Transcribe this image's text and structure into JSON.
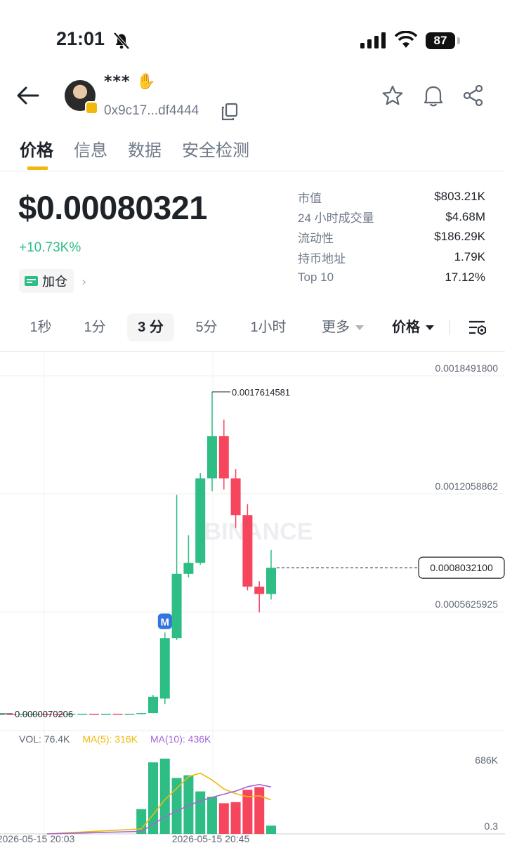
{
  "status_bar": {
    "time": "21:01",
    "battery": "87"
  },
  "header": {
    "token_name": "***",
    "address": "0x9c17...df4444"
  },
  "tabs": [
    {
      "label": "价格",
      "active": true
    },
    {
      "label": "信息",
      "active": false
    },
    {
      "label": "数据",
      "active": false
    },
    {
      "label": "安全检测",
      "active": false
    }
  ],
  "price": {
    "value": "$0.00080321",
    "change": "+10.73K%",
    "add_position_label": "加仓"
  },
  "stats": [
    {
      "label": "市值",
      "value": "$803.21K"
    },
    {
      "label": "24 小时成交量",
      "value": "$4.68M"
    },
    {
      "label": "流动性",
      "value": "$186.29K"
    },
    {
      "label": "持币地址",
      "value": "1.79K"
    },
    {
      "label": "Top 10",
      "value": "17.12%"
    }
  ],
  "intervals": {
    "s1": "1秒",
    "m1": "1分",
    "m3": "3 分",
    "m5": "5分",
    "h1": "1小时",
    "more": "更多",
    "price_type": "价格",
    "selected": "3 分"
  },
  "colors": {
    "up": "#2ebd85",
    "down": "#f6465d",
    "accent": "#f0b90b",
    "ma5": "#f0b90b",
    "ma10": "#a467d6"
  },
  "chart_data": {
    "type": "candlestick",
    "watermark": "BINANCE",
    "price_axis_labels": [
      "0.0018491800",
      "0.0012058862",
      "0.0005625925"
    ],
    "current_price_label": "0.0008032100",
    "high_label": "0.0017614581",
    "low_label": "0.0000070206",
    "marker": "M",
    "time_labels": [
      "2026-05-15 20:03",
      "2026-05-15 20:45"
    ],
    "candles": [
      [
        7e-06,
        7.2e-06,
        7e-06,
        7.3e-06
      ],
      [
        7.2e-06,
        7.1e-06,
        7e-06,
        7.3e-06
      ],
      [
        7.1e-06,
        7.2e-06,
        7e-06,
        7.3e-06
      ],
      [
        7.2e-06,
        7e-06,
        6.9e-06,
        7.3e-06
      ],
      [
        7e-06,
        7.1e-06,
        6.9e-06,
        7.2e-06
      ],
      [
        7.1e-06,
        7.3e-06,
        7e-06,
        7.4e-06
      ],
      [
        7.3e-06,
        7.2e-06,
        7.1e-06,
        7.4e-06
      ],
      [
        7.2e-06,
        7.1e-06,
        7e-06,
        7.3e-06
      ],
      [
        7.1e-06,
        7.2e-06,
        7e-06,
        7.3e-06
      ],
      [
        7.2e-06,
        7.3e-06,
        7.1e-06,
        7.4e-06
      ],
      [
        7.3e-06,
        7.2e-06,
        7.1e-06,
        7.4e-06
      ],
      [
        7.2e-06,
        7.3e-06,
        7.1e-06,
        7.4e-06
      ],
      [
        7.3e-06,
        7.2e-06,
        7.1e-06,
        7.4e-06
      ],
      [
        7.2e-06,
        7.4e-06,
        7.1e-06,
        7.5e-06
      ],
      [
        7.4e-06,
        1.1e-05,
        7e-06,
        1.2e-05
      ],
      [
        1.1e-05,
        0.0001,
        1e-05,
        0.00011
      ],
      [
        9e-05,
        0.00042,
        6e-05,
        0.00045
      ],
      [
        0.00042,
        0.00077,
        0.00041,
        0.0012
      ],
      [
        0.00077,
        0.00083,
        0.00075,
        0.00098
      ],
      [
        0.00083,
        0.00129,
        0.00082,
        0.00132
      ],
      [
        0.00129,
        0.00152,
        0.00122,
        0.0017614581
      ],
      [
        0.00152,
        0.00129,
        0.00123,
        0.00161
      ],
      [
        0.00129,
        0.00109,
        0.00102,
        0.00134
      ],
      [
        0.00109,
        0.0007,
        0.00068,
        0.00115
      ],
      [
        0.0007,
        0.00066,
        0.00056,
        0.00073
      ],
      [
        0.00066,
        0.0008032,
        0.00063,
        0.0009
      ]
    ],
    "volume": {
      "label": "VOL: 76.4K",
      "ma5_label": "MA(5): 316K",
      "ma10_label": "MA(10): 436K",
      "axis_labels": [
        "686K",
        "0.3"
      ],
      "values": [
        0.3,
        0.3,
        0.3,
        0.3,
        0.3,
        0.3,
        0.3,
        0.3,
        0.3,
        0.3,
        0.3,
        0.3,
        0.3,
        0.3,
        230000,
        665000,
        700000,
        520000,
        545000,
        395000,
        345000,
        285000,
        295000,
        410000,
        435000,
        76400
      ],
      "ma5": [
        null,
        null,
        null,
        null,
        0.3,
        0.3,
        0.3,
        0.3,
        0.3,
        0.3,
        0.3,
        0.3,
        0.3,
        0.3,
        46000,
        179000,
        319000,
        423000,
        532000,
        565000,
        501000,
        418000,
        373000,
        346000,
        354000,
        316000
      ],
      "ma10": [
        null,
        null,
        null,
        null,
        null,
        null,
        null,
        null,
        null,
        0.3,
        0.3,
        0.3,
        0.3,
        0.3,
        23000,
        89000,
        159000,
        211000,
        266000,
        305000,
        340000,
        369000,
        398000,
        438000,
        459000,
        436000
      ]
    }
  }
}
